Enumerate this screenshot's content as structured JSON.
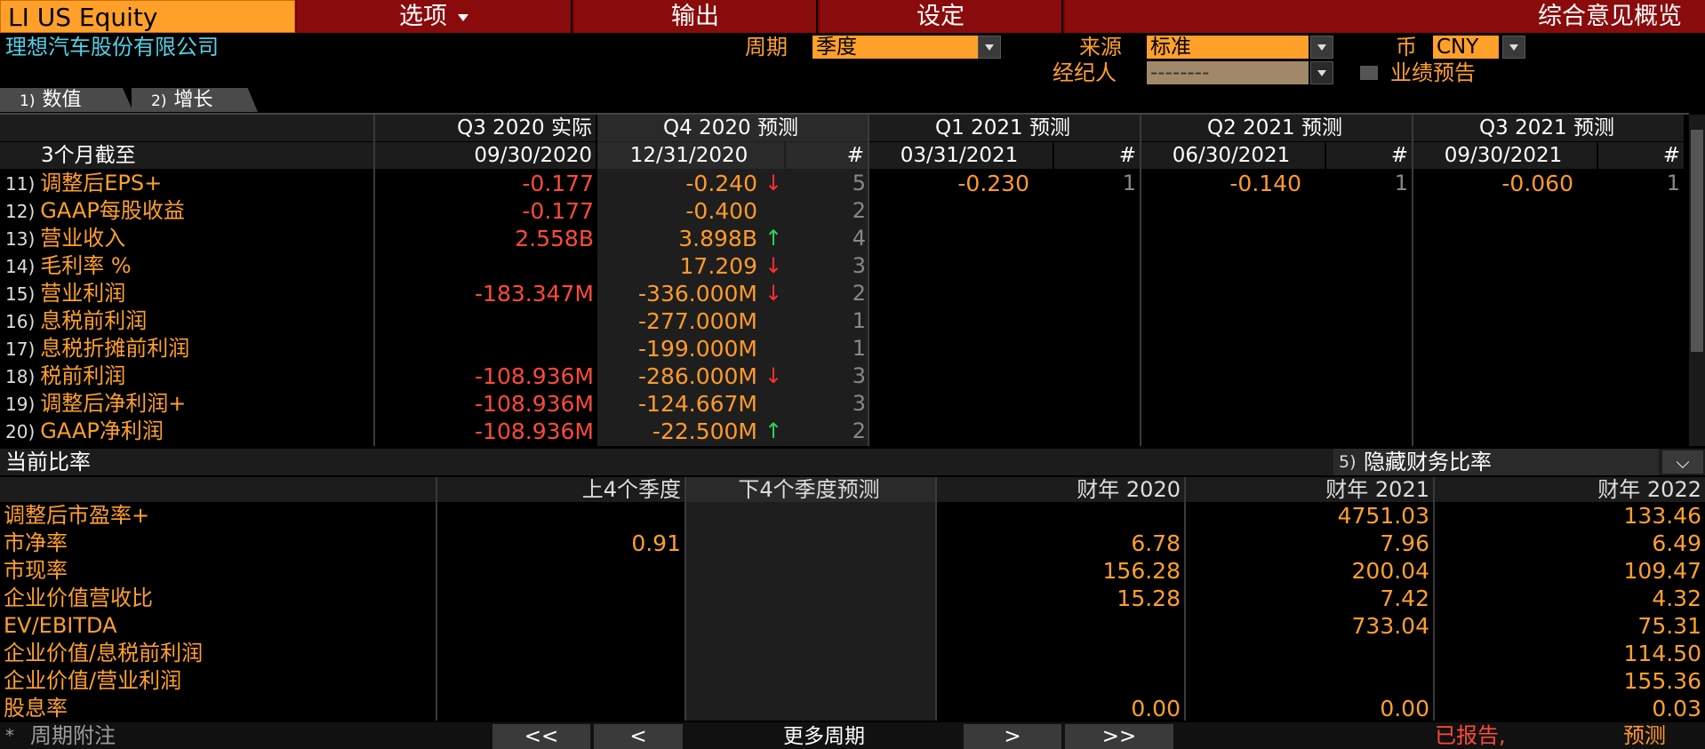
{
  "ticker": "LI US Equity",
  "menu": {
    "options": "选项",
    "output": "输出",
    "settings": "设定",
    "overview": "综合意见概览"
  },
  "company": "理想汽车股份有限公司",
  "filters": {
    "period_label": "周期",
    "period_value": "季度",
    "source_label": "来源",
    "source_value": "标准",
    "currency_label": "币",
    "currency_value": "CNY",
    "broker_label": "经纪人",
    "broker_value": "--------",
    "guidance_label": "业绩预告"
  },
  "tabs": [
    {
      "num": "1)",
      "label": "数值"
    },
    {
      "num": "2)",
      "label": "增长"
    }
  ],
  "table": {
    "period_end_label": "3个月截至",
    "hash": "#",
    "columns": [
      {
        "title": "Q3 2020 实际",
        "date": "09/30/2020"
      },
      {
        "title": "Q4 2020 预测",
        "date": "12/31/2020"
      },
      {
        "title": "Q1 2021 预测",
        "date": "03/31/2021"
      },
      {
        "title": "Q2 2021 预测",
        "date": "06/30/2021"
      },
      {
        "title": "Q3 2021 预测",
        "date": "09/30/2021"
      }
    ],
    "rows": [
      {
        "num": "11)",
        "label": "调整后EPS+",
        "actual": "-0.177",
        "q4": "-0.240",
        "q4_arrow": "down",
        "q4_n": "5",
        "q1": "-0.230",
        "q1_n": "1",
        "q2": "-0.140",
        "q2_n": "1",
        "q3": "-0.060",
        "q3_n": "1"
      },
      {
        "num": "12)",
        "label": "GAAP每股收益",
        "actual": "-0.177",
        "q4": "-0.400",
        "q4_arrow": "",
        "q4_n": "2"
      },
      {
        "num": "13)",
        "label": "营业收入",
        "actual": "2.558B",
        "q4": "3.898B",
        "q4_arrow": "up",
        "q4_n": "4"
      },
      {
        "num": "14)",
        "label": "毛利率 %",
        "actual": "",
        "q4": "17.209",
        "q4_arrow": "down",
        "q4_n": "3"
      },
      {
        "num": "15)",
        "label": "营业利润",
        "actual": "-183.347M",
        "q4": "-336.000M",
        "q4_arrow": "down",
        "q4_n": "2"
      },
      {
        "num": "16)",
        "label": "息税前利润",
        "actual": "",
        "q4": "-277.000M",
        "q4_arrow": "",
        "q4_n": "1"
      },
      {
        "num": "17)",
        "label": "息税折摊前利润",
        "actual": "",
        "q4": "-199.000M",
        "q4_arrow": "",
        "q4_n": "1"
      },
      {
        "num": "18)",
        "label": "税前利润",
        "actual": "-108.936M",
        "q4": "-286.000M",
        "q4_arrow": "down",
        "q4_n": "3"
      },
      {
        "num": "19)",
        "label": "调整后净利润+",
        "actual": "-108.936M",
        "q4": "-124.667M",
        "q4_arrow": "",
        "q4_n": "3"
      },
      {
        "num": "20)",
        "label": "GAAP净利润",
        "actual": "-108.936M",
        "q4": "-22.500M",
        "q4_arrow": "up",
        "q4_n": "2"
      }
    ]
  },
  "ratios": {
    "section_title": "当前比率",
    "hide_num": "5)",
    "hide_label": "隐藏财务比率",
    "headers": [
      "上4个季度",
      "下4个季度预测",
      "财年 2020",
      "财年 2021",
      "财年 2022"
    ],
    "rows": [
      {
        "label": "调整后市盈率+",
        "vals": [
          "",
          "",
          "",
          "4751.03",
          "133.46"
        ]
      },
      {
        "label": "市净率",
        "vals": [
          "0.91",
          "",
          "6.78",
          "7.96",
          "6.49"
        ]
      },
      {
        "label": "市现率",
        "vals": [
          "",
          "",
          "156.28",
          "200.04",
          "109.47"
        ]
      },
      {
        "label": "企业价值营收比",
        "vals": [
          "",
          "",
          "15.28",
          "7.42",
          "4.32"
        ]
      },
      {
        "label": "EV/EBITDA",
        "vals": [
          "",
          "",
          "",
          "733.04",
          "75.31"
        ]
      },
      {
        "label": "企业价值/息税前利润",
        "vals": [
          "",
          "",
          "",
          "",
          "114.50"
        ]
      },
      {
        "label": "企业价值/营业利润",
        "vals": [
          "",
          "",
          "",
          "",
          "155.36"
        ]
      },
      {
        "label": "股息率",
        "vals": [
          "",
          "",
          "0.00",
          "0.00",
          "0.03"
        ]
      }
    ]
  },
  "footer": {
    "note_star": "*",
    "note": "周期附注",
    "first": "<<",
    "prev": "<",
    "more": "更多周期",
    "next": ">",
    "last": ">>",
    "reported": "已报告,",
    "forecast": "预测"
  },
  "colors": {
    "accent": "#ffa02a",
    "negative": "#ff4a3a",
    "menu": "#8a0b0b",
    "up": "#2fd35a",
    "down": "#ff3030"
  }
}
